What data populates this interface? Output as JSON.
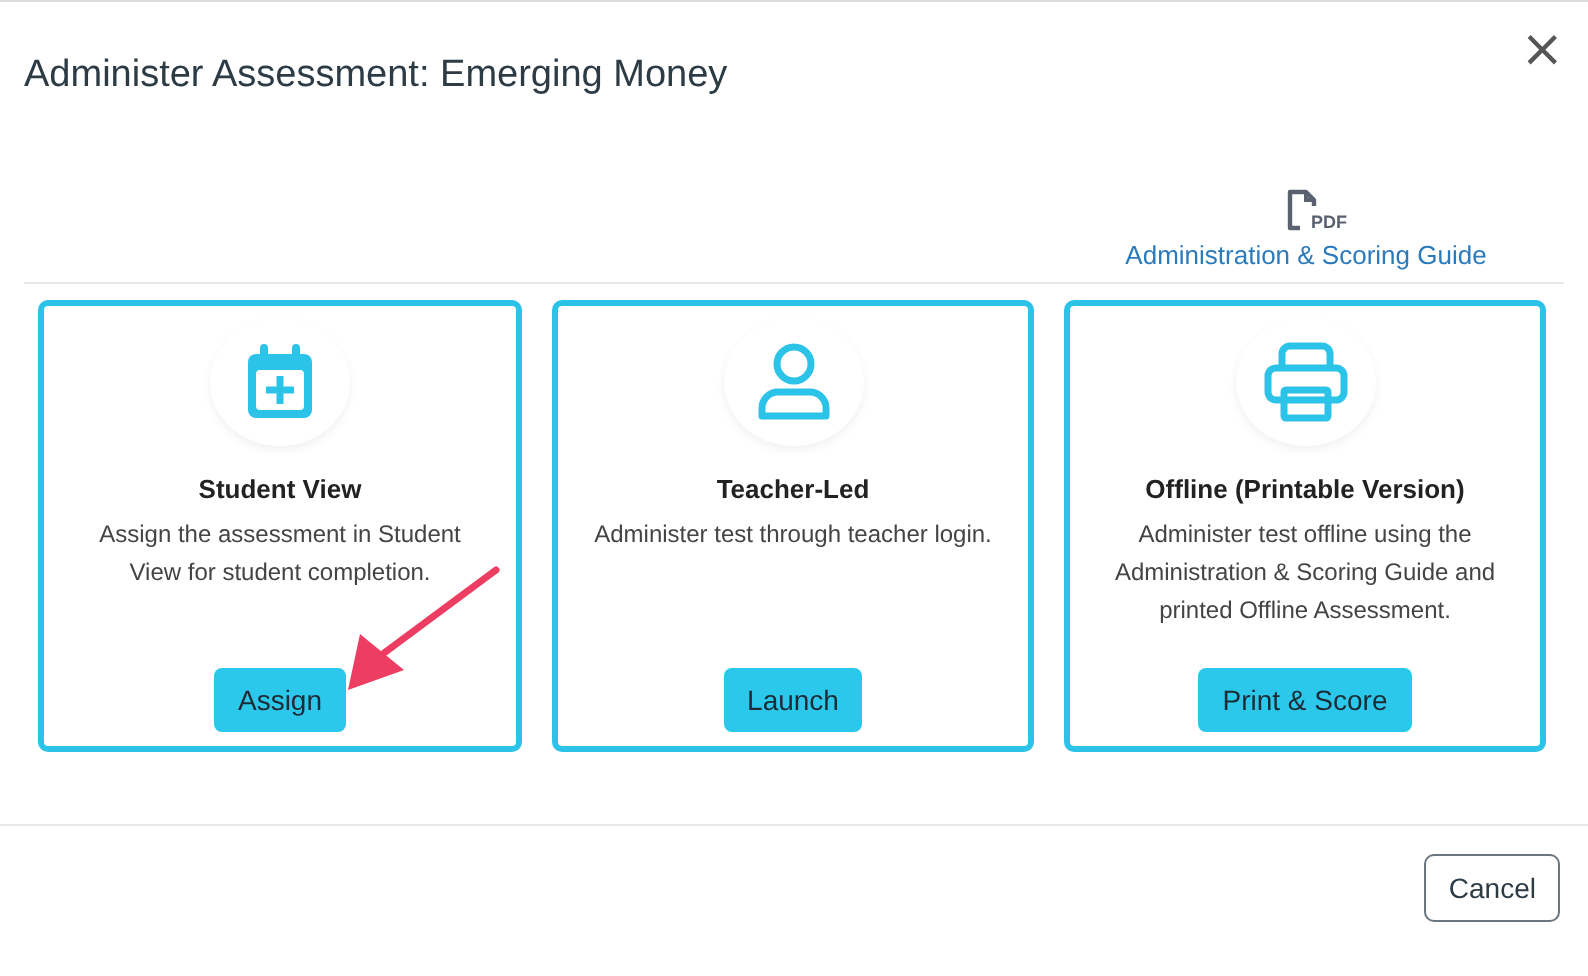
{
  "dialog": {
    "title": "Administer Assessment: Emerging Money",
    "close": "×"
  },
  "guide_link": {
    "icon_text": "PDF",
    "label": "Administration & Scoring Guide"
  },
  "options": [
    {
      "title": "Student View",
      "description": "Assign the assessment in Student View for student completion.",
      "button": "Assign"
    },
    {
      "title": "Teacher-Led",
      "description": "Administer test through teacher login.",
      "button": "Launch"
    },
    {
      "title": "Offline (Printable Version)",
      "description": "Administer test offline using the Administration & Scoring Guide and printed Offline Assessment.",
      "button": "Print & Score"
    }
  ],
  "footer": {
    "buttons": [
      "Cancel"
    ]
  }
}
